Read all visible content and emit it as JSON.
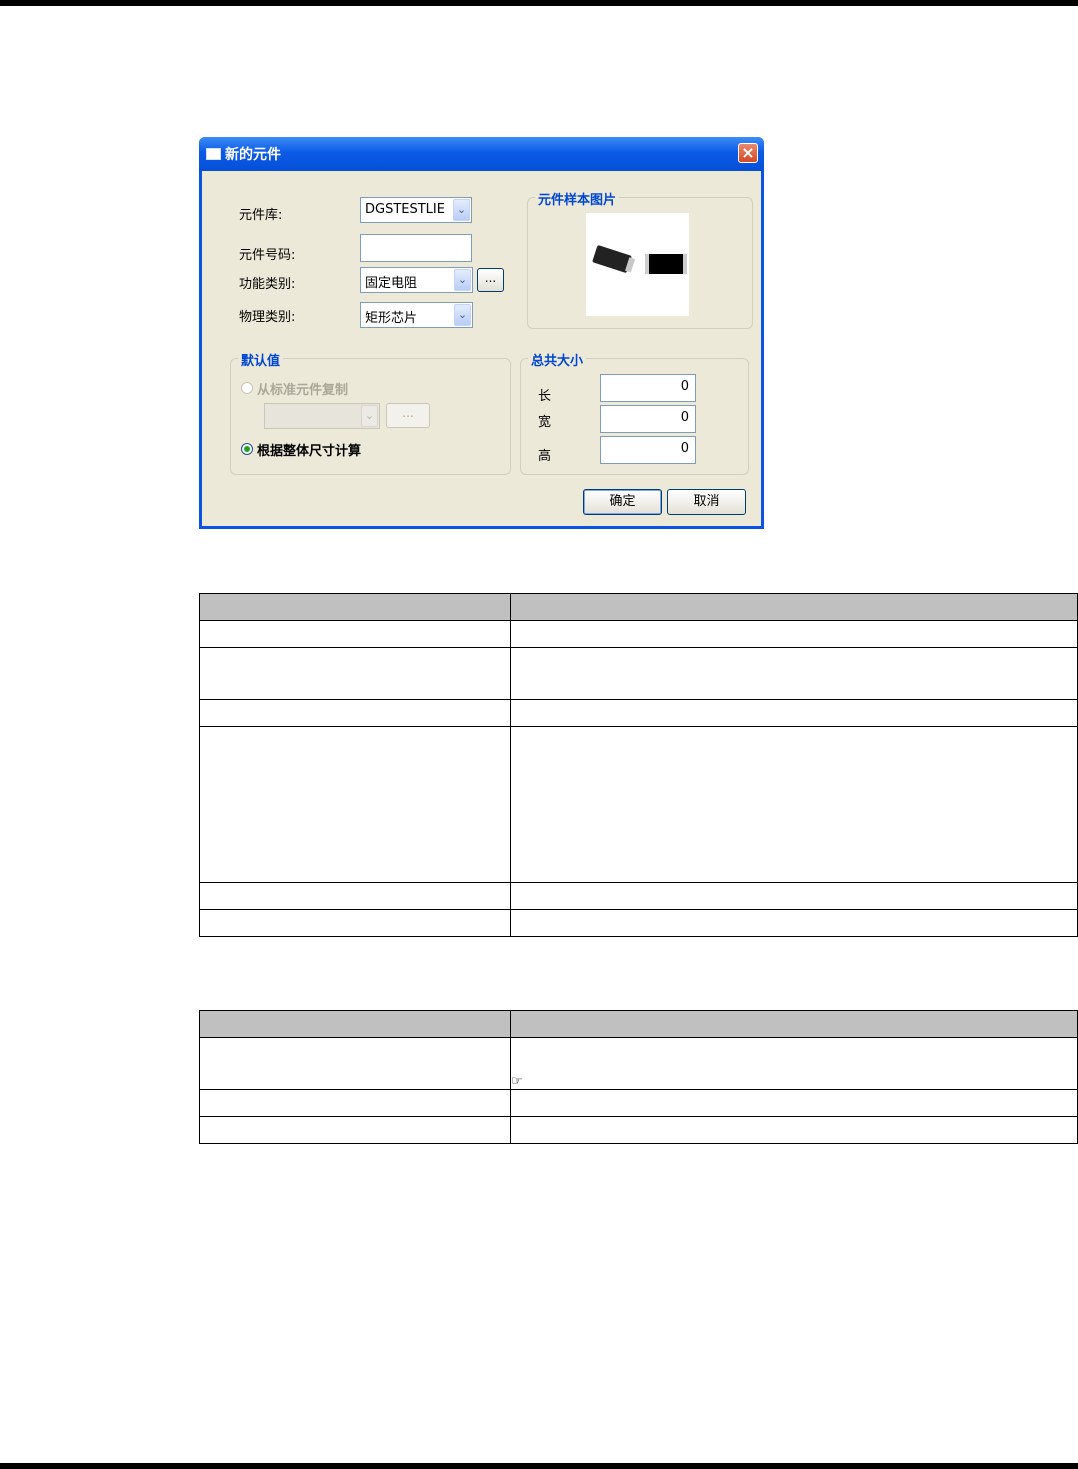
{
  "dialog": {
    "title": "新的元件",
    "close_icon": "close-icon",
    "labels": {
      "library": "元件库:",
      "part_number": "元件号码:",
      "function_category": "功能类别:",
      "physical_category": "物理类别:"
    },
    "library_value": "DGSTESTLIE",
    "part_number_value": "",
    "function_category_value": "固定电阻",
    "physical_category_value": "矩形芯片",
    "browse_label": "...",
    "sample_group_title": "元件样本图片",
    "default_group": {
      "title": "默认值",
      "radio_copy": "从标准元件复制",
      "copy_combo_value": "",
      "copy_browse_label": "...",
      "radio_calc": "根据整体尺寸计算"
    },
    "size_group": {
      "title": "总共大小",
      "length_label": "长",
      "width_label": "宽",
      "height_label": "高",
      "length_value": "0",
      "width_value": "0",
      "height_value": "0"
    },
    "ok_label": "确定",
    "cancel_label": "取消"
  },
  "tables": {
    "first_rows": 7,
    "second_rows": 4,
    "hand_icon": "☞"
  }
}
